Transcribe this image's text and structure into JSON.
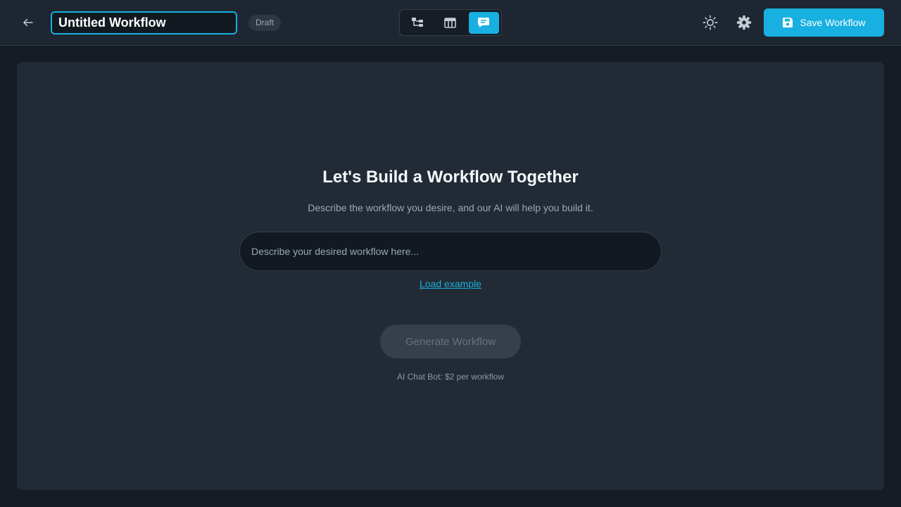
{
  "header": {
    "title_value": "Untitled Workflow",
    "status_badge": "Draft",
    "view_modes": [
      {
        "name": "diagram",
        "icon": "hierarchy-icon",
        "active": false
      },
      {
        "name": "table",
        "icon": "table-icon",
        "active": false
      },
      {
        "name": "chat",
        "icon": "chat-icon",
        "active": true
      }
    ],
    "save_label": "Save Workflow"
  },
  "main": {
    "heading": "Let's Build a Workflow Together",
    "subheading": "Describe the workflow you desire, and our AI will help you build it.",
    "prompt_placeholder": "Describe your desired workflow here...",
    "load_example_label": "Load example",
    "generate_label": "Generate Workflow",
    "pricing_note": "AI Chat Bot: $2 per workflow"
  },
  "colors": {
    "accent": "#17b0e0",
    "topbar_bg": "#1e2731",
    "page_bg": "#151c24",
    "panel_bg": "#222b35"
  }
}
